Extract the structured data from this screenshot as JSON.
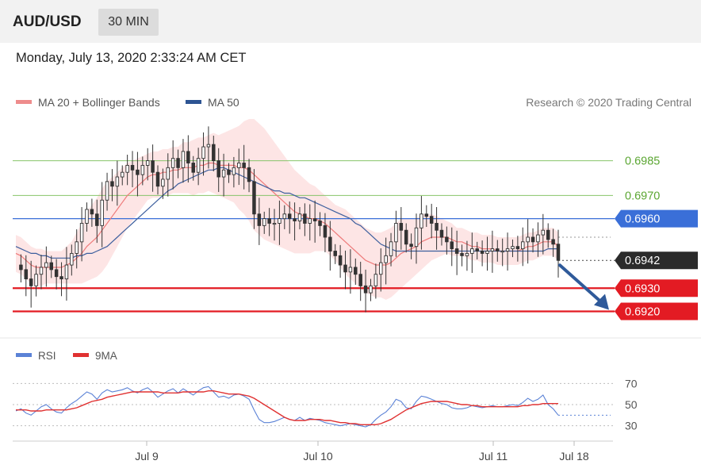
{
  "header": {
    "symbol": "AUD/USD",
    "timeframe": "30 MIN",
    "datetime": "Monday, July 13, 2020 2:33:24 AM CET"
  },
  "legend": {
    "ma20_label": "MA 20 + Bollinger Bands",
    "ma50_label": "MA 50",
    "credit": "Research © 2020 Trading Central"
  },
  "rsi_legend": {
    "rsi_label": "RSI",
    "ma9_label": "9MA"
  },
  "colors": {
    "ma20": "#ee7b7b",
    "ma50": "#3d5f9e",
    "bands_fill": "#fde0e0",
    "resistance": "#87c46a",
    "pivot": "#3a6fd8",
    "support": "#e31b23",
    "current": "#2b2b2b",
    "arrow": "#2f5a9a",
    "candle": "#333333",
    "rsi": "#5b82d6",
    "rsi_ma": "#e03131"
  },
  "chart_data": {
    "type": "candlestick",
    "price_axis": {
      "min": 0.6914,
      "max": 0.7003
    },
    "levels": [
      {
        "value": 0.6985,
        "label": "0.6985",
        "kind": "resistance"
      },
      {
        "value": 0.697,
        "label": "0.6970",
        "kind": "resistance"
      },
      {
        "value": 0.696,
        "label": "0.6960",
        "kind": "pivot"
      },
      {
        "value": 0.6942,
        "label": "0.6942",
        "kind": "current"
      },
      {
        "value": 0.693,
        "label": "0.6930",
        "kind": "support"
      },
      {
        "value": 0.692,
        "label": "0.6920",
        "kind": "support"
      }
    ],
    "x_ticks": [
      "Jul 9",
      "Jul 10",
      "Jul 11",
      "Jul 18"
    ],
    "close_path": [
      0.694,
      0.6938,
      0.6934,
      0.6931,
      0.6936,
      0.6939,
      0.6941,
      0.6938,
      0.6935,
      0.6934,
      0.694,
      0.6945,
      0.695,
      0.6958,
      0.6964,
      0.6962,
      0.6957,
      0.6968,
      0.6976,
      0.6974,
      0.6978,
      0.698,
      0.6983,
      0.6981,
      0.6979,
      0.6983,
      0.6985,
      0.698,
      0.6974,
      0.6977,
      0.6982,
      0.6986,
      0.6982,
      0.6989,
      0.6984,
      0.698,
      0.6986,
      0.6991,
      0.6992,
      0.6985,
      0.6978,
      0.6981,
      0.6979,
      0.6982,
      0.6984,
      0.6982,
      0.6976,
      0.6962,
      0.6957,
      0.696,
      0.6958,
      0.6958,
      0.696,
      0.6962,
      0.696,
      0.6959,
      0.6962,
      0.6958,
      0.696,
      0.6959,
      0.6957,
      0.6952,
      0.6946,
      0.6944,
      0.694,
      0.6937,
      0.6939,
      0.6936,
      0.6931,
      0.6928,
      0.6931,
      0.6936,
      0.6941,
      0.6944,
      0.695,
      0.6958,
      0.6955,
      0.6949,
      0.6948,
      0.6956,
      0.6962,
      0.6961,
      0.6958,
      0.6955,
      0.6952,
      0.695,
      0.6947,
      0.6945,
      0.6944,
      0.6945,
      0.6947,
      0.6946,
      0.6945,
      0.6946,
      0.6947,
      0.6946,
      0.6946,
      0.6947,
      0.6948,
      0.6947,
      0.695,
      0.6952,
      0.695,
      0.6953,
      0.6955,
      0.6951,
      0.6949,
      0.6942
    ],
    "ma20": [
      0.6945,
      0.6944,
      0.6942,
      0.694,
      0.6939,
      0.6939,
      0.6939,
      0.6939,
      0.6939,
      0.6939,
      0.694,
      0.6941,
      0.6943,
      0.6945,
      0.6948,
      0.695,
      0.6952,
      0.6955,
      0.6958,
      0.6961,
      0.6964,
      0.6967,
      0.697,
      0.6972,
      0.6974,
      0.6976,
      0.6978,
      0.6979,
      0.6979,
      0.698,
      0.698,
      0.6981,
      0.6981,
      0.6982,
      0.6982,
      0.6982,
      0.6983,
      0.6983,
      0.6984,
      0.6984,
      0.6983,
      0.6983,
      0.6983,
      0.6983,
      0.6982,
      0.6982,
      0.6981,
      0.6979,
      0.6977,
      0.6975,
      0.6973,
      0.6971,
      0.6969,
      0.6967,
      0.6965,
      0.6963,
      0.6962,
      0.6961,
      0.696,
      0.696,
      0.6959,
      0.6958,
      0.6956,
      0.6954,
      0.6952,
      0.695,
      0.6948,
      0.6946,
      0.6944,
      0.6942,
      0.6941,
      0.694,
      0.694,
      0.694,
      0.6941,
      0.6943,
      0.6945,
      0.6946,
      0.6947,
      0.6948,
      0.695,
      0.6951,
      0.6952,
      0.6952,
      0.6952,
      0.6952,
      0.6951,
      0.695,
      0.695,
      0.6949,
      0.6948,
      0.6948,
      0.6947,
      0.6947,
      0.6947,
      0.6946,
      0.6946,
      0.6946,
      0.6946,
      0.6946,
      0.6947,
      0.6948,
      0.6948,
      0.6949,
      0.695,
      0.695,
      0.695,
      0.6948
    ],
    "ma50": [
      0.6948,
      0.6947,
      0.6946,
      0.6945,
      0.6945,
      0.6944,
      0.6944,
      0.6943,
      0.6943,
      0.6943,
      0.6943,
      0.6943,
      0.6944,
      0.6944,
      0.6945,
      0.6945,
      0.6946,
      0.6947,
      0.6948,
      0.695,
      0.6952,
      0.6954,
      0.6956,
      0.6958,
      0.696,
      0.6962,
      0.6964,
      0.6966,
      0.6968,
      0.697,
      0.6972,
      0.6973,
      0.6975,
      0.6976,
      0.6977,
      0.6978,
      0.6979,
      0.698,
      0.6981,
      0.6981,
      0.6982,
      0.6982,
      0.6981,
      0.698,
      0.6979,
      0.6978,
      0.6977,
      0.6976,
      0.6975,
      0.6974,
      0.6973,
      0.6972,
      0.6972,
      0.6971,
      0.6971,
      0.697,
      0.6969,
      0.6969,
      0.6968,
      0.6967,
      0.6966,
      0.6965,
      0.6964,
      0.6963,
      0.6962,
      0.6961,
      0.696,
      0.6958,
      0.6957,
      0.6955,
      0.6953,
      0.6951,
      0.6949,
      0.6948,
      0.6947,
      0.6946,
      0.6946,
      0.6946,
      0.6946,
      0.6946,
      0.6946,
      0.6946,
      0.6946,
      0.6946,
      0.6946,
      0.6946,
      0.6946,
      0.6946,
      0.6946,
      0.6946,
      0.6946,
      0.6946,
      0.6946,
      0.6946,
      0.6946,
      0.6946,
      0.6946,
      0.6946,
      0.6946,
      0.6946,
      0.6946,
      0.6946,
      0.6946,
      0.6946,
      0.6946,
      0.6947,
      0.6947,
      0.6947
    ],
    "band_width": [
      0.0008,
      0.0008,
      0.0008,
      0.0008,
      0.0008,
      0.0008,
      0.0007,
      0.0007,
      0.0007,
      0.0007,
      0.0008,
      0.0009,
      0.0011,
      0.0013,
      0.0015,
      0.0016,
      0.0017,
      0.0018,
      0.0018,
      0.0017,
      0.0016,
      0.0015,
      0.0014,
      0.0013,
      0.0012,
      0.0011,
      0.001,
      0.001,
      0.001,
      0.001,
      0.001,
      0.001,
      0.001,
      0.0011,
      0.0011,
      0.0012,
      0.0012,
      0.0012,
      0.0012,
      0.0013,
      0.0013,
      0.0014,
      0.0015,
      0.0016,
      0.0018,
      0.002,
      0.0022,
      0.0024,
      0.0024,
      0.0024,
      0.0023,
      0.0022,
      0.0021,
      0.002,
      0.0019,
      0.0018,
      0.0017,
      0.0016,
      0.0015,
      0.0014,
      0.0013,
      0.0012,
      0.0012,
      0.0012,
      0.0013,
      0.0014,
      0.0014,
      0.0014,
      0.0014,
      0.0014,
      0.0014,
      0.0014,
      0.0014,
      0.0015,
      0.0015,
      0.0015,
      0.0015,
      0.0014,
      0.0013,
      0.0012,
      0.0012,
      0.0011,
      0.001,
      0.0009,
      0.0008,
      0.0007,
      0.0007,
      0.0006,
      0.0006,
      0.0006,
      0.0006,
      0.0006,
      0.0006,
      0.0006,
      0.0006,
      0.0006,
      0.0006,
      0.0006,
      0.0006,
      0.0006,
      0.0006,
      0.0006,
      0.0006,
      0.0006,
      0.0006,
      0.0006,
      0.0006,
      0.0006
    ],
    "forecast": {
      "from": 0.6942,
      "to": 0.692
    },
    "rsi_axis": {
      "min": 20,
      "max": 80,
      "ticks": [
        70,
        50,
        30
      ]
    },
    "rsi": [
      44,
      46,
      42,
      40,
      44,
      48,
      50,
      46,
      43,
      42,
      47,
      51,
      54,
      58,
      62,
      60,
      55,
      61,
      64,
      62,
      63,
      64,
      66,
      63,
      61,
      64,
      66,
      62,
      57,
      60,
      63,
      65,
      61,
      65,
      62,
      59,
      63,
      66,
      67,
      62,
      57,
      58,
      56,
      59,
      60,
      58,
      55,
      45,
      36,
      33,
      33,
      34,
      36,
      38,
      36,
      35,
      38,
      35,
      37,
      36,
      35,
      33,
      32,
      31,
      30,
      31,
      32,
      31,
      30,
      29,
      31,
      36,
      40,
      43,
      48,
      55,
      53,
      47,
      46,
      53,
      58,
      57,
      55,
      53,
      51,
      50,
      47,
      46,
      46,
      47,
      49,
      48,
      47,
      48,
      49,
      48,
      48,
      49,
      50,
      49,
      52,
      56,
      53,
      55,
      59,
      50,
      46,
      40
    ],
    "rsi_ma": [
      45,
      45,
      45,
      44,
      44,
      44,
      45,
      45,
      45,
      45,
      45,
      46,
      47,
      49,
      51,
      53,
      54,
      55,
      57,
      58,
      59,
      60,
      61,
      62,
      62,
      62,
      62,
      62,
      62,
      61,
      61,
      61,
      61,
      62,
      62,
      62,
      62,
      62,
      63,
      63,
      62,
      61,
      60,
      60,
      60,
      59,
      58,
      56,
      53,
      50,
      47,
      44,
      41,
      38,
      36,
      35,
      35,
      35,
      36,
      36,
      36,
      35,
      35,
      34,
      33,
      33,
      32,
      32,
      31,
      31,
      31,
      31,
      32,
      34,
      36,
      39,
      42,
      45,
      47,
      49,
      51,
      52,
      53,
      53,
      53,
      53,
      52,
      51,
      50,
      50,
      49,
      49,
      48,
      48,
      48,
      48,
      48,
      48,
      48,
      48,
      49,
      49,
      50,
      50,
      51,
      51,
      51,
      51
    ]
  }
}
